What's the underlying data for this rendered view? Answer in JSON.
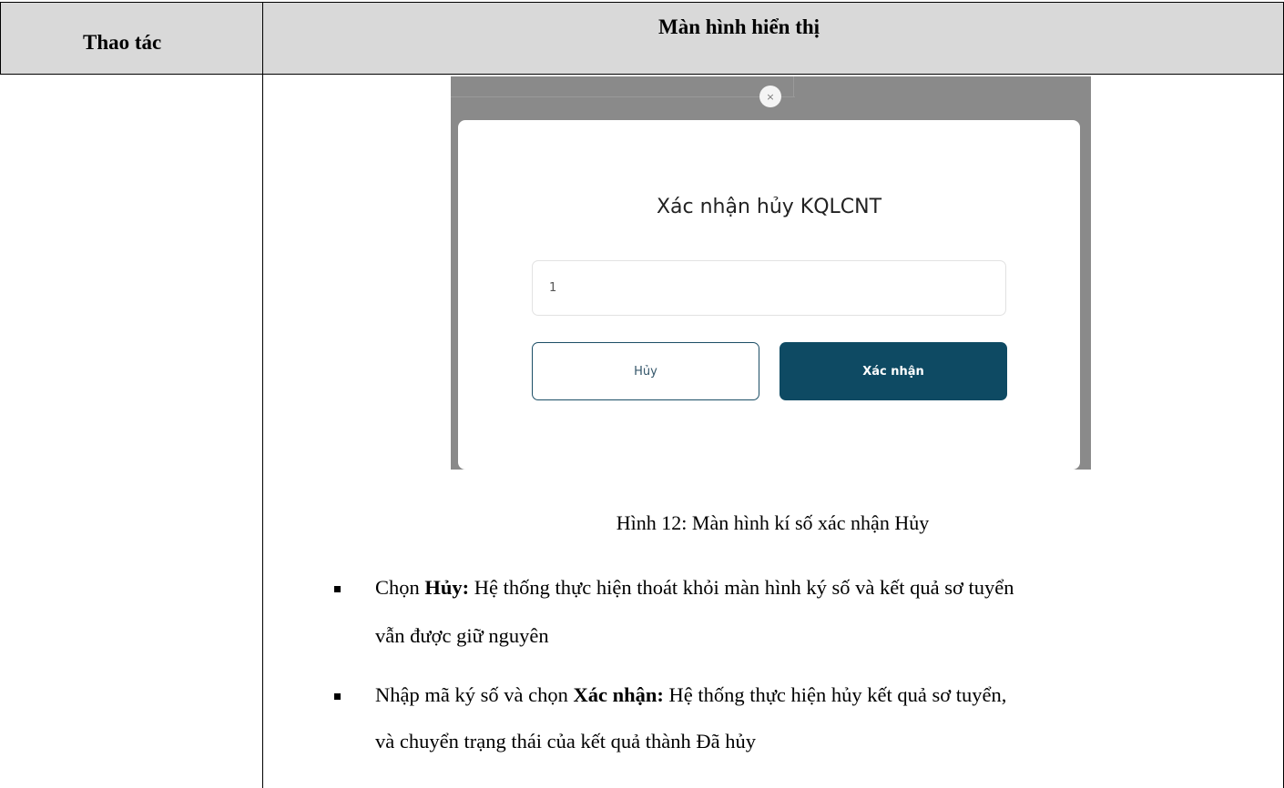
{
  "table": {
    "col1_header": "Thao tác",
    "col2_header": "Màn hình hiển thị"
  },
  "dialog": {
    "close_glyph": "×",
    "title": "Xác nhận hủy KQLCNT",
    "input_value": "1",
    "cancel_label": "Hủy",
    "confirm_label": "Xác nhận"
  },
  "caption": "Hình 12: Màn hình kí số xác nhận Hủy",
  "bullets": [
    {
      "prefix": "Chọn ",
      "bold": "Hủy:",
      "line1_rest": " Hệ thống thực hiện thoát khỏi màn hình ký số và kết quả sơ tuyển",
      "line2": "vẫn được giữ nguyên"
    },
    {
      "prefix": "Nhập mã ký số và chọn ",
      "bold": "Xác nhận:",
      "line1_rest": " Hệ thống thực hiện hủy kết quả sơ tuyển,",
      "line2": "và chuyển trạng thái của kết quả thành Đã hủy"
    }
  ]
}
